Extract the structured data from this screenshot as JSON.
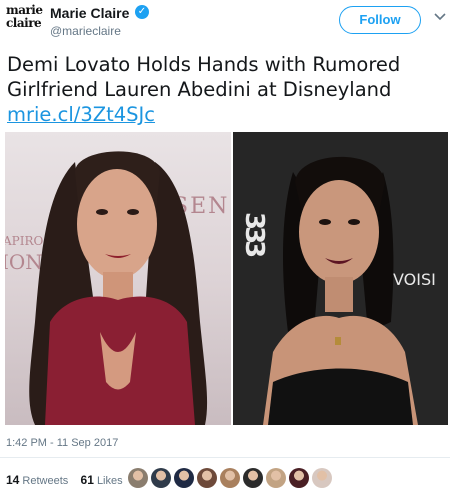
{
  "account": {
    "logo_line1": "marie",
    "logo_line2": "claire",
    "name": "Marie Claire",
    "handle": "@marieclaire",
    "verified_icon": "verified-badge-icon"
  },
  "follow_button": {
    "label": "Follow"
  },
  "menu_icon": "chevron-down-icon",
  "tweet": {
    "text": "Demi Lovato Holds Hands with Rumored Girlfriend Lauren Abedini at Disneyland",
    "link": "mrie.cl/3Zt4SJc"
  },
  "media": {
    "left_bg_text_1": "SEN",
    "left_bg_text_2": "APIRO",
    "left_bg_text_3": "ION",
    "right_bg_text_1": "333",
    "right_bg_text_2": "VOISI"
  },
  "timestamp": "1:42 PM - 11 Sep 2017",
  "stats": {
    "retweets_count": "14",
    "retweets_label": "Retweets",
    "likes_count": "61",
    "likes_label": "Likes"
  },
  "liker_avatars": [
    "#8a7d6e",
    "#2f3b4a",
    "#1f2a44",
    "#6e4a3a",
    "#a9805e",
    "#2b2b2b",
    "#c2a383",
    "#4a1f24",
    "#d8c8c0"
  ],
  "colors": {
    "accent": "#1da1f2",
    "text": "#14171a",
    "muted": "#657786"
  }
}
